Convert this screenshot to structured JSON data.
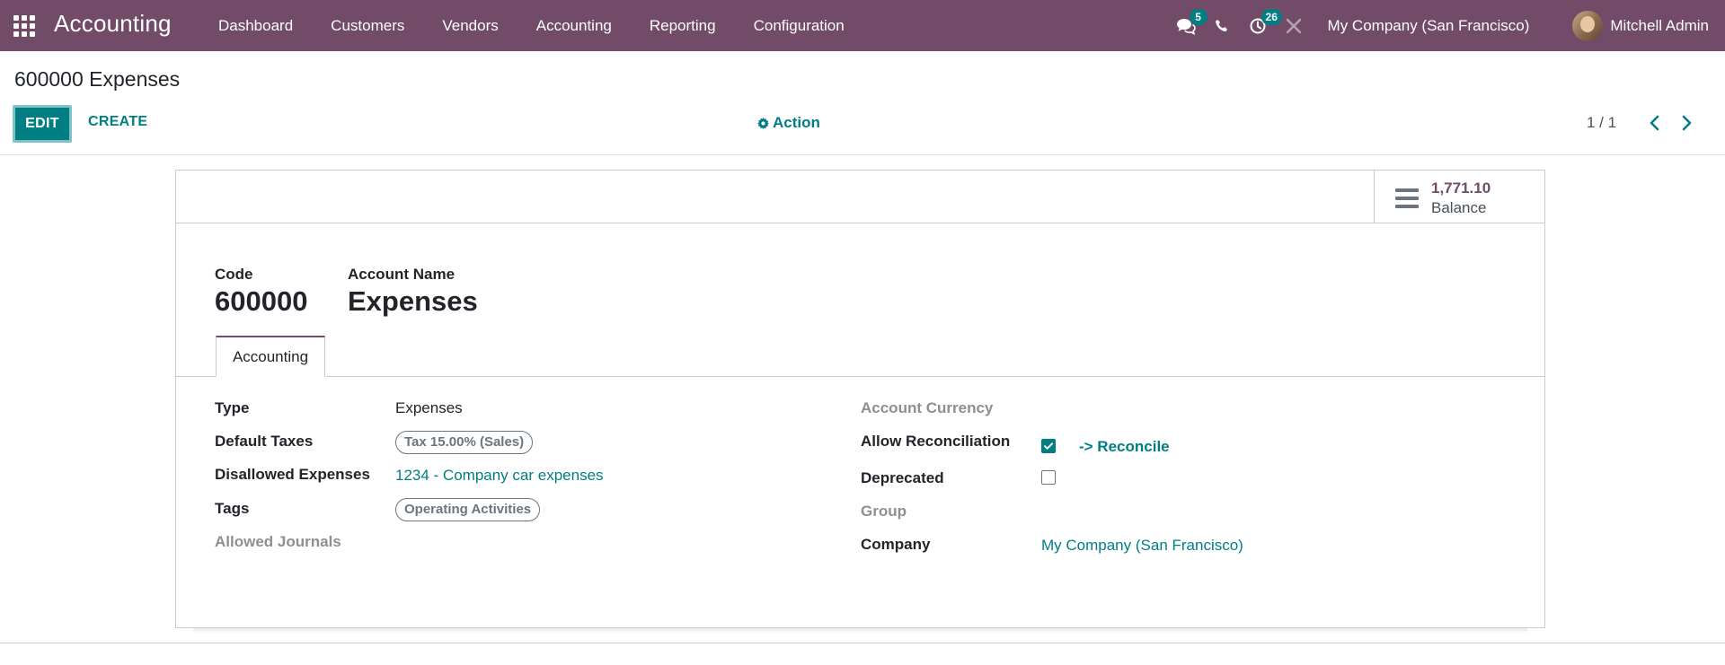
{
  "navbar": {
    "app_title": "Accounting",
    "menu": [
      "Dashboard",
      "Customers",
      "Vendors",
      "Accounting",
      "Reporting",
      "Configuration"
    ],
    "messages_count": "5",
    "activities_count": "26",
    "company": "My Company (San Francisco)",
    "user": "Mitchell Admin",
    "bg_color": "#714B67"
  },
  "control_panel": {
    "breadcrumb": "600000 Expenses",
    "edit_label": "EDIT",
    "create_label": "CREATE",
    "action_label": "Action",
    "pager": "1 / 1"
  },
  "smart_button": {
    "value": "1,771.10",
    "label": "Balance"
  },
  "record": {
    "code_label": "Code",
    "code": "600000",
    "name_label": "Account Name",
    "name": "Expenses",
    "tab_label": "Accounting",
    "left_fields": {
      "type_label": "Type",
      "type_value": "Expenses",
      "default_taxes_label": "Default Taxes",
      "default_taxes_tag": "Tax 15.00% (Sales)",
      "disallowed_label": "Disallowed Expenses",
      "disallowed_value": "1234 - Company car expenses",
      "tags_label": "Tags",
      "tags_tag": "Operating Activities",
      "allowed_journals_label": "Allowed Journals"
    },
    "right_fields": {
      "currency_label": "Account Currency",
      "reconcile_label": "Allow Reconciliation",
      "reconcile_checked": true,
      "reconcile_link": "-> Reconcile",
      "deprecated_label": "Deprecated",
      "deprecated_checked": false,
      "group_label": "Group",
      "company_label": "Company",
      "company_value": "My Company (San Francisco)"
    }
  },
  "accent_color": "#017e84"
}
